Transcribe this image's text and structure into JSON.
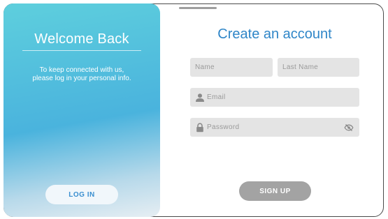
{
  "left_panel": {
    "title": "Welcome Back",
    "message_line1": "To keep connected with us,",
    "message_line2": "please log in your personal info.",
    "login_label": "LOG IN"
  },
  "form": {
    "title": "Create an account",
    "name_placeholder": "Name",
    "last_name_placeholder": "Last Name",
    "email_placeholder": "Email",
    "password_placeholder": "Password",
    "signup_label": "SIGN UP"
  },
  "icons": {
    "email": "user-icon",
    "password": "lock-icon",
    "toggle_password": "eye-slash-icon"
  },
  "colors": {
    "accent": "#2f86c8",
    "gradient_top": "#5ecfdd",
    "gradient_mid": "#4ab3dd",
    "field_bg": "#e4e4e4",
    "signup_bg": "#a3a3a3"
  }
}
